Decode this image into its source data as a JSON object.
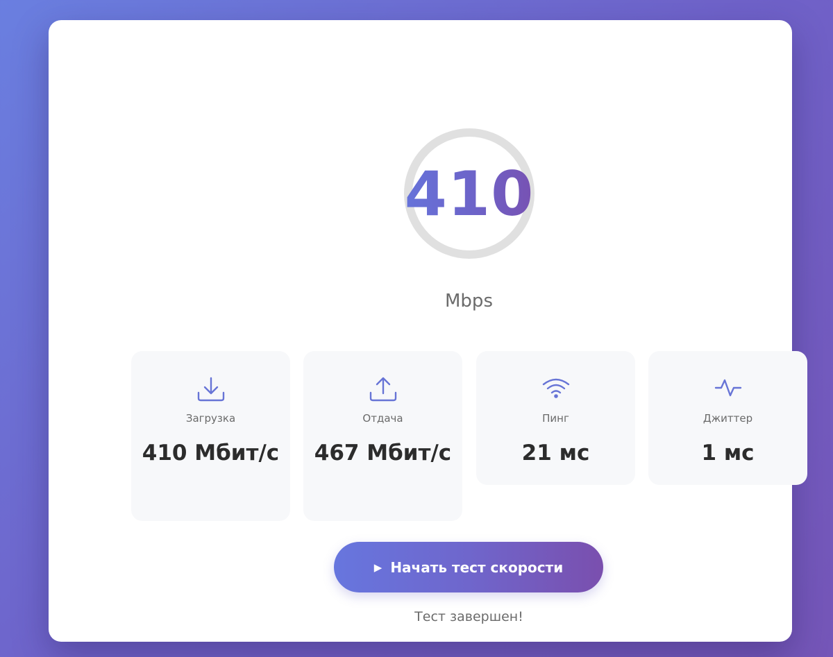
{
  "gauge": {
    "value": "410",
    "unit": "Mbps"
  },
  "stats": [
    {
      "icon": "download-icon",
      "label": "Загрузка",
      "value": "410 Мбит/с"
    },
    {
      "icon": "upload-icon",
      "label": "Отдача",
      "value": "467 Мбит/с"
    },
    {
      "icon": "wifi-icon",
      "label": "Пинг",
      "value": "21 мс"
    },
    {
      "icon": "activity-icon",
      "label": "Джиттер",
      "value": "1 мс"
    }
  ],
  "start_button": {
    "icon": "play-icon",
    "label": "Начать тест скорости"
  },
  "status_text": "Тест завершен!",
  "colors": {
    "accent_start": "#667eea",
    "accent_end": "#764ba2",
    "ring": "#e0e0e0",
    "card_bg": "#f7f8fa"
  }
}
